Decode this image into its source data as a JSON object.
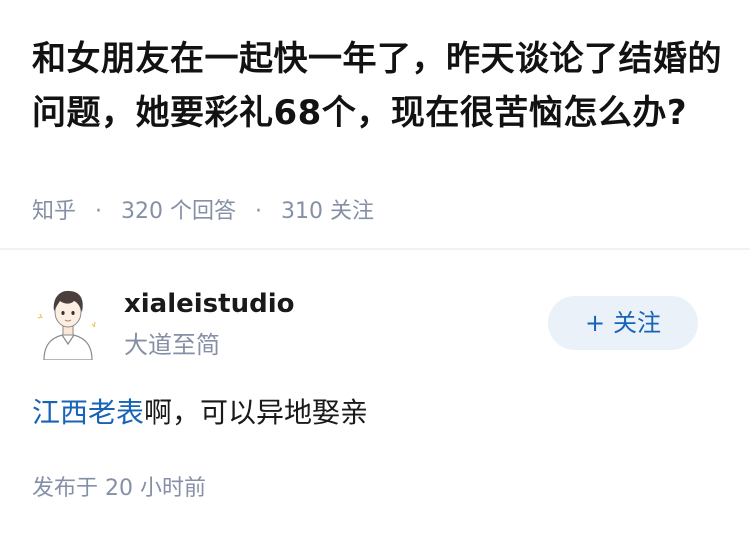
{
  "question": {
    "title": "和女朋友在一起快一年了，昨天谈论了结婚的问题，她要彩礼68个，现在很苦恼怎么办?",
    "source": "知乎",
    "separator": "·",
    "answers_count": "320",
    "answers_label": "个回答",
    "followers_count": "310",
    "followers_label": "关注"
  },
  "answer": {
    "author": {
      "name": "xialeistudio",
      "bio": "大道至简",
      "avatar": "avatar-illustration"
    },
    "follow_button": {
      "icon": "+",
      "label": "关注"
    },
    "link_text": "江西老表",
    "text_after_link": "啊，可以异地娶亲",
    "time": {
      "prefix": "发布于",
      "value": "20 小时前"
    }
  },
  "colors": {
    "link": "#1763b8",
    "meta": "#8590a6",
    "title": "#121212",
    "follow_bg": "#eaf1f9",
    "divider": "#f1f1f3"
  }
}
